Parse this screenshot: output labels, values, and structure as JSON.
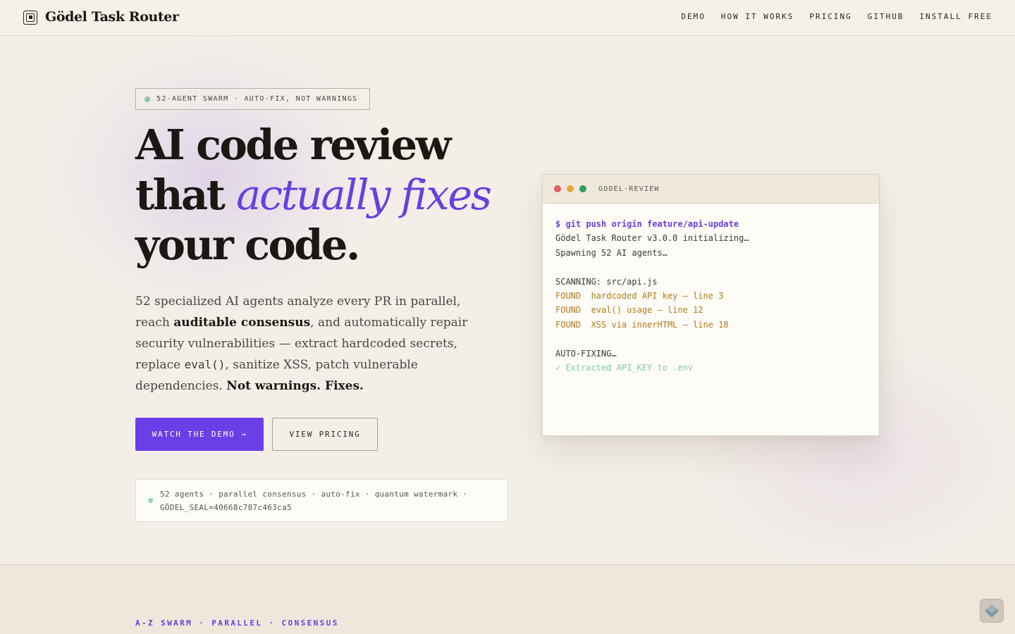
{
  "brand": {
    "name": "Gödel Task Router",
    "icon": "nested-squares-logo-icon"
  },
  "nav": [
    {
      "label": "DEMO"
    },
    {
      "label": "HOW IT WORKS"
    },
    {
      "label": "PRICING"
    },
    {
      "label": "GITHUB"
    },
    {
      "label": "INSTALL FREE"
    }
  ],
  "hero": {
    "pill": "52-AGENT SWARM · AUTO-FIX, NOT WARNINGS",
    "headline": {
      "line1": "AI code review",
      "line2_plain": "that ",
      "line2_accent": "actually fixes",
      "line3": "your code."
    },
    "lede": {
      "p1": "52 specialized AI agents analyze every PR in parallel, reach ",
      "b1": "auditable consensus",
      "p2": ", and automatically repair security vulnerabilities — extract hardcoded secrets, replace ",
      "code": "eval()",
      "p3": ", sanitize XSS, patch vulnerable dependencies. ",
      "b2": "Not warnings. Fixes."
    },
    "primary_button": "WATCH THE DEMO →",
    "secondary_button": "VIEW PRICING",
    "meta": "52 agents · parallel consensus · auto-fix · quantum watermark · GÖDEL_SEAL=40668c787c463ca5"
  },
  "terminal": {
    "title": "GODEL-REVIEW",
    "lines": [
      {
        "text": "$ git push origin feature/api-update",
        "kind": "cmd"
      },
      {
        "text": "Gödel Task Router v3.0.0 initializing…",
        "kind": "out"
      },
      {
        "text": "Spawning 52 AI agents…",
        "kind": "out"
      },
      {
        "text": "",
        "kind": "out"
      },
      {
        "text": "SCANNING: src/api.js",
        "kind": "out"
      },
      {
        "text": "FOUND  hardcoded API key — line 3",
        "kind": "found"
      },
      {
        "text": "FOUND  eval() usage — line 12",
        "kind": "found"
      },
      {
        "text": "FOUND  XSS via innerHTML — line 18",
        "kind": "found"
      },
      {
        "text": "",
        "kind": "out"
      },
      {
        "text": "AUTO-FIXING…",
        "kind": "out"
      },
      {
        "text": "✓ Extracted API_KEY to .env",
        "kind": "ok"
      }
    ]
  },
  "section2": {
    "eyebrow": "A-Z SWARM · PARALLEL · CONSENSUS"
  },
  "colors": {
    "accent": "#6a3fe8",
    "background": "#f3efe8",
    "found": "#b27a18",
    "success": "#7fcaa5",
    "dot_red": "#e35d5b",
    "dot_yellow": "#e6a83a",
    "dot_green": "#2f9e5b"
  }
}
